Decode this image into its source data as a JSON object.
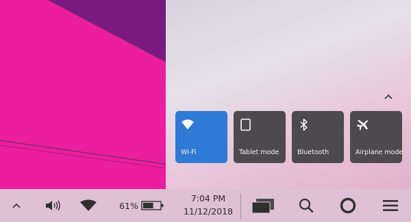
{
  "quick_actions": {
    "tiles": [
      {
        "label": "Wi-Fi",
        "icon": "wifi-icon",
        "active": true
      },
      {
        "label": "Tablet mode",
        "icon": "tablet-icon",
        "active": false
      },
      {
        "label": "Bluetooth",
        "icon": "bluetooth-icon",
        "active": false
      },
      {
        "label": "Airplane mode",
        "icon": "airplane-icon",
        "active": false
      }
    ],
    "collapse_icon": "chevron-up-icon"
  },
  "taskbar": {
    "show_hidden_icon": "chevron-up-icon",
    "volume_icon": "speaker-icon",
    "network_icon": "wifi-icon",
    "battery_percent": "61%",
    "battery_level": 0.61,
    "time": "7:04 PM",
    "date": "11/12/2018",
    "task_view_icon": "task-view-icon",
    "search_icon": "search-icon",
    "cortana_icon": "cortana-ring-icon",
    "action_center_icon": "hamburger-icon"
  },
  "colors": {
    "wallpaper_magenta": "#ec1ea0",
    "wallpaper_purple": "#7a1a7e",
    "tile_active": "#2f7ad6",
    "tile_inactive": "#4d4a4d",
    "taskbar": "#dfc1d5"
  }
}
